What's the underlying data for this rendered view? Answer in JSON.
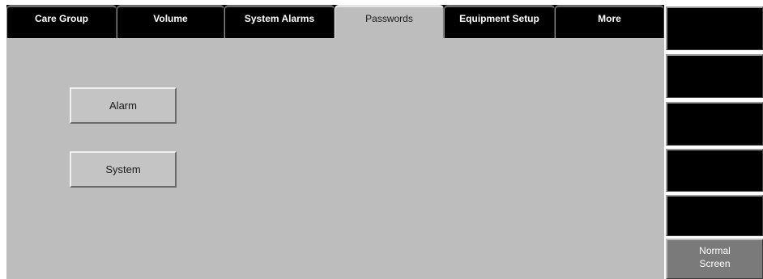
{
  "tabs": [
    {
      "label": "Care Group",
      "active": false
    },
    {
      "label": "Volume",
      "active": false
    },
    {
      "label": "System Alarms",
      "active": false
    },
    {
      "label": "Passwords",
      "active": true
    },
    {
      "label": "Equipment Setup",
      "active": false
    },
    {
      "label": "More",
      "active": false
    }
  ],
  "content": {
    "alarm_button": "Alarm",
    "system_button": "System"
  },
  "softkeys": {
    "normal_screen_line1": "Normal",
    "normal_screen_line2": "Screen"
  },
  "colors": {
    "panel_bg": "#bdbdbd",
    "tab_bg": "#000000",
    "softkey_bg": "#000000",
    "normal_screen_bg": "#7a7a7a"
  }
}
